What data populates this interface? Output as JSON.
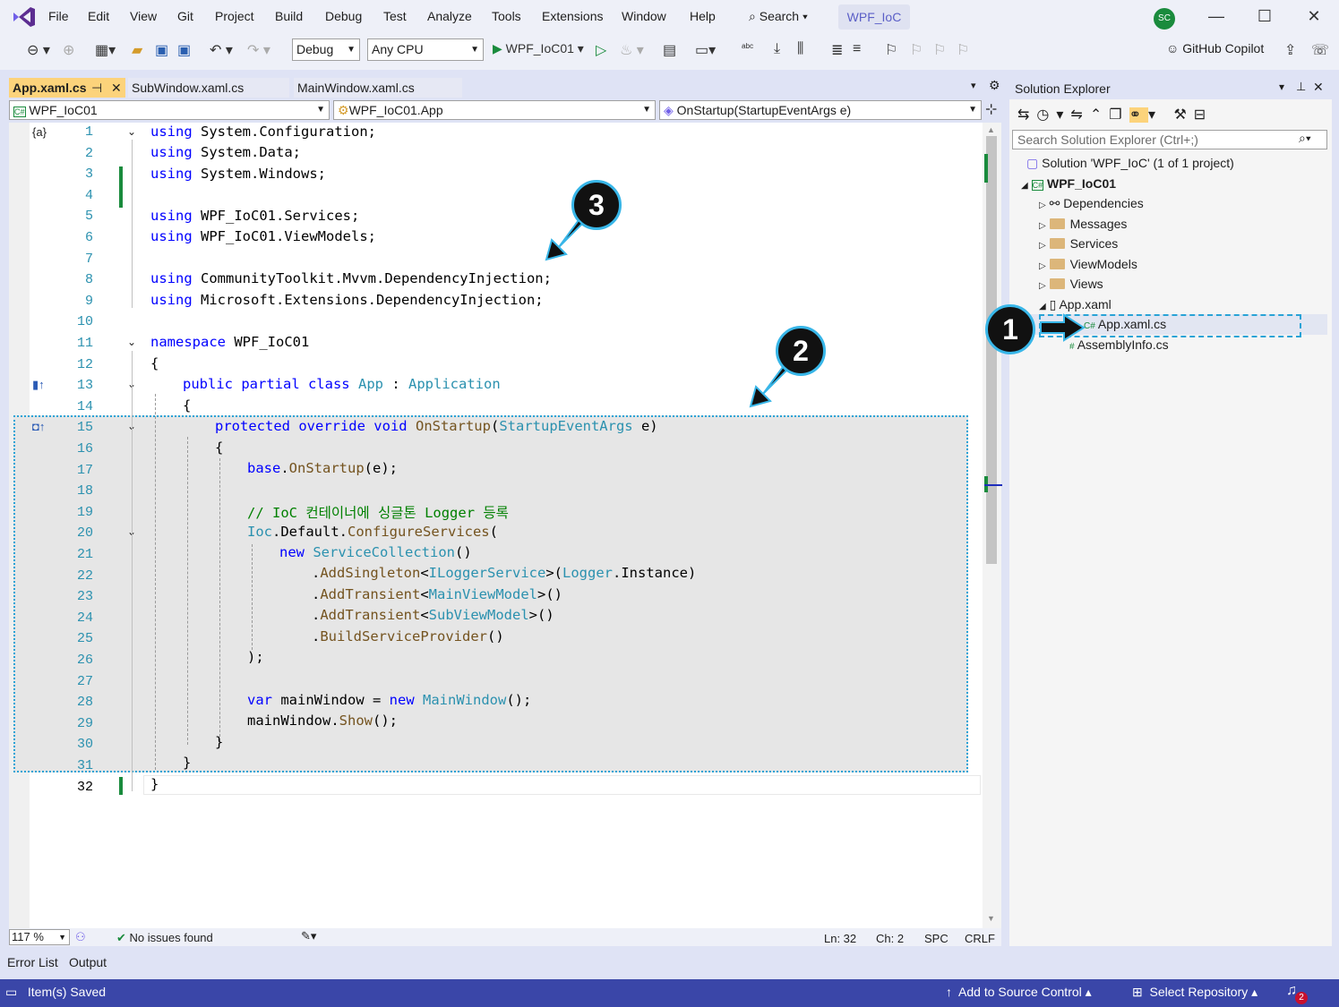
{
  "menu": [
    "File",
    "Edit",
    "View",
    "Git",
    "Project",
    "Build",
    "Debug",
    "Test",
    "Analyze",
    "Tools",
    "Extensions",
    "Window",
    "Help"
  ],
  "search_label": "Search",
  "solution_badge": "WPF_IoC",
  "avatar": "SC",
  "toolbar": {
    "config": "Debug",
    "platform": "Any CPU",
    "startup": "WPF_IoC01",
    "copilot": "GitHub Copilot"
  },
  "tabs": [
    "App.xaml.cs",
    "SubWindow.xaml.cs",
    "MainWindow.xaml.cs"
  ],
  "nav": {
    "project": "WPF_IoC01",
    "class": "WPF_IoC01.App",
    "member": "OnStartup(StartupEventArgs e)"
  },
  "line_numbers": [
    "1",
    "2",
    "3",
    "4",
    "5",
    "6",
    "7",
    "8",
    "9",
    "10",
    "11",
    "12",
    "13",
    "14",
    "15",
    "16",
    "17",
    "18",
    "19",
    "20",
    "21",
    "22",
    "23",
    "24",
    "25",
    "26",
    "27",
    "28",
    "29",
    "30",
    "31",
    "32"
  ],
  "code": {
    "l1": "System.Configuration;",
    "l2": "System.Data;",
    "l3": "System.Windows;",
    "l5": "WPF_IoC01.Services;",
    "l6": "WPF_IoC01.ViewModels;",
    "l8": "CommunityToolkit.Mvvm.DependencyInjection;",
    "l9": "Microsoft.Extensions.DependencyInjection;",
    "kw_using": "using",
    "kw_namespace": "namespace",
    "ns_name": "WPF_IoC01",
    "l13_kw": "public partial class",
    "l13_name": "App",
    "l13_colon": ":",
    "l13_base": "Application",
    "l15_kw": "protected override void",
    "l15_m": "OnStartup",
    "l15_p": "(",
    "l15_t": "StartupEventArgs",
    "l15_e": " e)",
    "l17_kw": "base",
    "l17_rest": ".",
    "l17_m": "OnStartup",
    "l17_end": "(e);",
    "l19": "// IoC 컨테이너에 싱글톤 Logger 등록",
    "l20_t": "Ioc",
    "l20_a": ".Default.",
    "l20_m": "ConfigureServices",
    "l20_b": "(",
    "l21_kw": "new",
    "l21_t": "ServiceCollection",
    "l21_b": "()",
    "l22_a": ".",
    "l22_m": "AddSingleton",
    "l22_b": "<",
    "l22_t": "ILoggerService",
    "l22_c": ">(",
    "l22_t2": "Logger",
    "l22_d": ".Instance)",
    "l23_a": ".",
    "l23_m": "AddTransient",
    "l23_b": "<",
    "l23_t": "MainViewModel",
    "l23_c": ">()",
    "l24_a": ".",
    "l24_m": "AddTransient",
    "l24_b": "<",
    "l24_t": "SubViewModel",
    "l24_c": ">()",
    "l25_a": ".",
    "l25_m": "BuildServiceProvider",
    "l25_b": "()",
    "l26": ");",
    "l28_kw": "var",
    "l28_a": " mainWindow = ",
    "l28_kw2": "new",
    "l28_t": "MainWindow",
    "l28_b": "();",
    "l29_a": "mainWindow.",
    "l29_m": "Show",
    "l29_b": "();",
    "brace_open": "{",
    "brace_close": "}"
  },
  "editor_status": {
    "zoom": "117 %",
    "issues": "No issues found",
    "ln": "Ln: 32",
    "ch": "Ch: 2",
    "spc": "SPC",
    "crlf": "CRLF"
  },
  "solution_explorer": {
    "title": "Solution Explorer",
    "search_placeholder": "Search Solution Explorer (Ctrl+;)",
    "solution": "Solution 'WPF_IoC' (1 of 1 project)",
    "project": "WPF_IoC01",
    "items": [
      "Dependencies",
      "Messages",
      "Services",
      "ViewModels",
      "Views",
      "App.xaml",
      "App.xaml.cs",
      "AssemblyInfo.cs"
    ]
  },
  "bottom_tabs": [
    "Error List",
    "Output"
  ],
  "statusbar": {
    "saved": "Item(s) Saved",
    "source_control": "Add to Source Control",
    "repo": "Select Repository",
    "notif": "2"
  },
  "callouts": [
    "1",
    "2",
    "3"
  ],
  "colors": {
    "accent": "#5b5fc7",
    "statusbar": "#3a46a8",
    "tab_active": "#fcd37b",
    "callout_border": "#38b6e8"
  }
}
